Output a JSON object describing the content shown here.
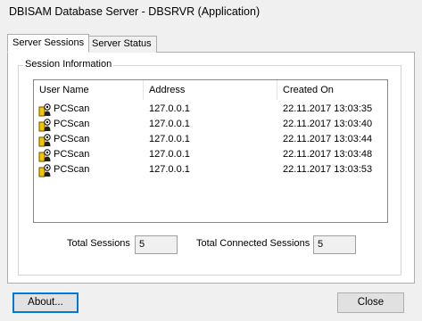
{
  "window": {
    "title": "DBISAM Database Server - DBSRVR (Application)"
  },
  "tabs": [
    {
      "label": "Server Sessions",
      "active": true
    },
    {
      "label": "Server Status",
      "active": false
    }
  ],
  "session_info": {
    "caption": "Session Information",
    "columns": [
      "User Name",
      "Address",
      "Created On"
    ],
    "row_icon": "user-key-icon",
    "rows": [
      {
        "user": "PCScan",
        "address": "127.0.0.1",
        "created": "22.11.2017 13:03:35"
      },
      {
        "user": "PCScan",
        "address": "127.0.0.1",
        "created": "22.11.2017 13:03:40"
      },
      {
        "user": "PCScan",
        "address": "127.0.0.1",
        "created": "22.11.2017 13:03:44"
      },
      {
        "user": "PCScan",
        "address": "127.0.0.1",
        "created": "22.11.2017 13:03:48"
      },
      {
        "user": "PCScan",
        "address": "127.0.0.1",
        "created": "22.11.2017 13:03:53"
      }
    ],
    "total_sessions_label": "Total Sessions",
    "total_sessions_value": "5",
    "total_connected_label": "Total Connected Sessions",
    "total_connected_value": "5"
  },
  "buttons": {
    "about": "About...",
    "close": "Close"
  },
  "colors": {
    "focus_border": "#0078d7",
    "icon_yellow": "#f5c400"
  }
}
